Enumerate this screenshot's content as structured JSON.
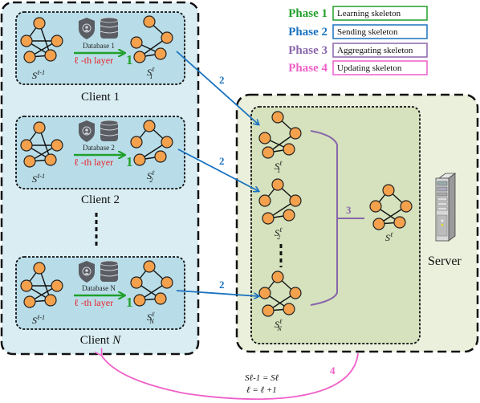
{
  "legend": [
    {
      "phase": "Phase 1",
      "description": "Learning skeleton",
      "color": "#22a02c"
    },
    {
      "phase": "Phase 2",
      "description": "Sending skeleton",
      "color": "#1a72c0"
    },
    {
      "phase": "Phase 3",
      "description": "Aggregating skeleton",
      "color": "#8866aa"
    },
    {
      "phase": "Phase 4",
      "description": "Updating skeleton",
      "color": "#ef5fc8"
    }
  ],
  "clients": [
    {
      "name": "Client 1",
      "database": "Database 1",
      "layer": "ℓ -th layer",
      "step": "1",
      "input_symbol": "S",
      "input_sup": "ℓ-1",
      "output_symbol": "S",
      "output_sup": "ℓ",
      "output_sub": "1"
    },
    {
      "name": "Client 2",
      "database": "Database 2",
      "layer": "ℓ -th layer",
      "step": "1",
      "input_symbol": "S",
      "input_sup": "ℓ-1",
      "output_symbol": "S",
      "output_sup": "ℓ",
      "output_sub": "2"
    },
    {
      "name": "Client N",
      "database": "Database N",
      "layer": "ℓ -th layer",
      "step": "1",
      "input_symbol": "S",
      "input_sup": "ℓ-1",
      "output_symbol": "S",
      "output_sup": "ℓ",
      "output_sub": "N"
    }
  ],
  "client_N_name_parts": {
    "prefix": "Client ",
    "italic": "N"
  },
  "send_step": "2",
  "aggregate_step": "3",
  "update_step": "4",
  "server": {
    "label": "Server",
    "received": [
      {
        "symbol": "S",
        "sup": "ℓ",
        "sub": "1"
      },
      {
        "symbol": "S",
        "sup": "ℓ",
        "sub": "2"
      },
      {
        "symbol": "S",
        "sup": "ℓ",
        "sub": "N"
      }
    ],
    "aggregated": {
      "symbol": "S",
      "sup": "ℓ"
    }
  },
  "update_equations": {
    "line1": "Sℓ-1 = Sℓ",
    "line2": "ℓ = ℓ +1"
  },
  "colors": {
    "node_fill": "#f4a14d",
    "client_panel": "#d9edf3",
    "client_inner": "#b8dde8",
    "server_panel": "#eaf0dc",
    "server_inner": "#d5e2bd",
    "icon_gray": "#5a5d63"
  }
}
